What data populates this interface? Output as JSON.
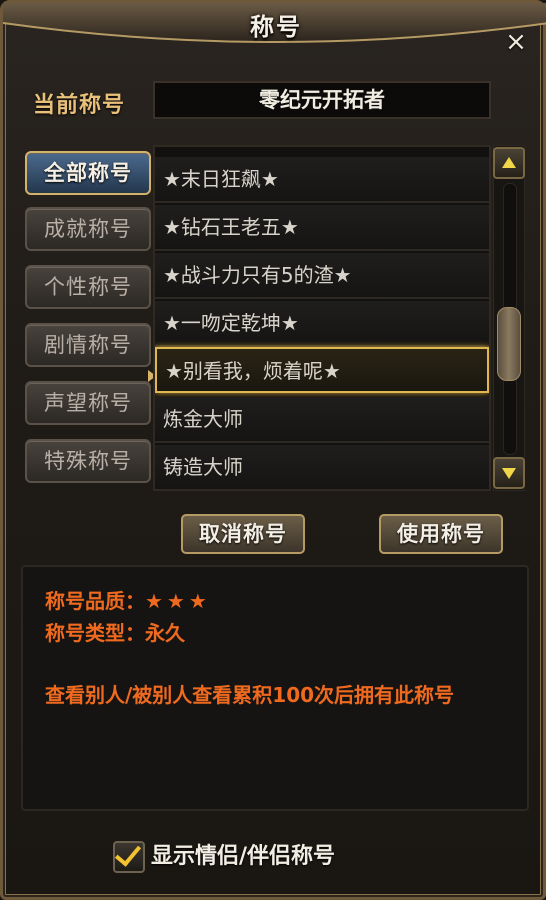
{
  "window": {
    "title": "称号",
    "close_glyph": "×"
  },
  "current": {
    "label": "当前称号",
    "value": "零纪元开拓者"
  },
  "tabs": [
    {
      "label": "全部称号",
      "active": true
    },
    {
      "label": "成就称号",
      "active": false
    },
    {
      "label": "个性称号",
      "active": false
    },
    {
      "label": "剧情称号",
      "active": false
    },
    {
      "label": "声望称号",
      "active": false
    },
    {
      "label": "特殊称号",
      "active": false
    }
  ],
  "titles": [
    {
      "label": "★末日狂飙★",
      "selected": false
    },
    {
      "label": "★钻石王老五★",
      "selected": false
    },
    {
      "label": "★战斗力只有5的渣★",
      "selected": false
    },
    {
      "label": "★一吻定乾坤★",
      "selected": false
    },
    {
      "label": "★别看我，烦着呢★",
      "selected": true
    },
    {
      "label": "炼金大师",
      "selected": false
    },
    {
      "label": "铸造大师",
      "selected": false
    }
  ],
  "actions": {
    "cancel_label": "取消称号",
    "use_label": "使用称号"
  },
  "info": {
    "quality_label": "称号品质：",
    "quality_stars": "★★★",
    "type_label": "称号类型：",
    "type_value": "永久",
    "description": "查看别人/被别人查看累积100次后拥有此称号"
  },
  "option": {
    "label": "显示情侣/伴侣称号",
    "checked": true
  },
  "colors": {
    "accent_gold": "#e0b852",
    "info_orange": "#ef6a1f",
    "current_label": "#e8c07a",
    "active_tab": "#4b6a8e"
  },
  "icons": {
    "close": "close-icon",
    "scroll_up": "arrow-up-icon",
    "scroll_down": "arrow-down-icon",
    "check": "checkmark-icon"
  }
}
